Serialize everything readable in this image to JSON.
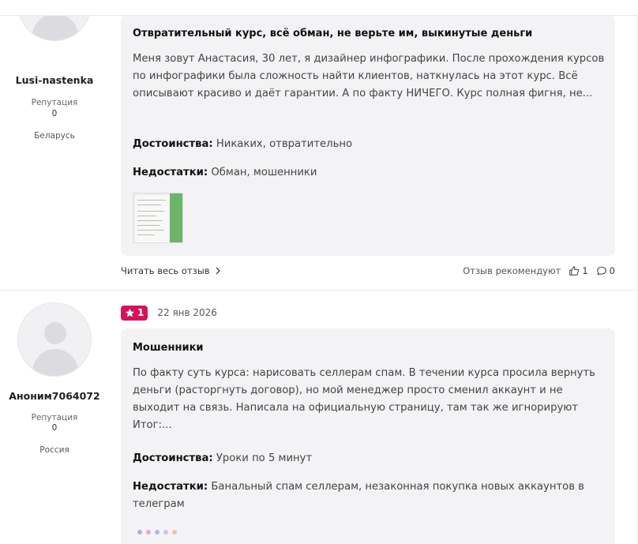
{
  "reviews": [
    {
      "author": {
        "name": "Lusi-nastenka",
        "reputation_label": "Репутация",
        "reputation_value": "0",
        "country": "Беларусь"
      },
      "title": "Отвратительный курс, всё обман, не верьте им, выкинутые деньги",
      "text": "Меня зовут Анастасия, 30 лет, я дизайнер инфографики. После прохождения курсов по инфографики была сложность найти клиентов, наткнулась на этот курс. Всё описывают красиво и даёт гарантии. А по факту НИЧЕГО. Курс полная фигня, не...",
      "pros_label": "Достоинства:",
      "pros": "Никаких, отвратительно",
      "cons_label": "Недостатки:",
      "cons": "Обман, мошенники",
      "read_more": "Читать весь отзыв",
      "recommend_label": "Отзыв рекомендуют",
      "likes": "1",
      "comments": "0"
    },
    {
      "rating": "1",
      "date": "22 янв 2026",
      "author": {
        "name": "Аноним7064072",
        "reputation_label": "Репутация",
        "reputation_value": "0",
        "country": "Россия"
      },
      "title": "Мошенники",
      "text": "По факту суть курса: нарисовать селлерам спам. В течении курса просила вернуть деньги (расторгнуть договор), но мой менеджер просто сменил аккаунт и не выходит на связь. Написала на официальную страницу, там так же игнорируют Итог:...",
      "pros_label": "Достоинства:",
      "pros": "Уроки по 5 минут",
      "cons_label": "Недостатки:",
      "cons": "Банальный спам селлерам, незаконная покупка новых аккаунтов в телеграм"
    }
  ],
  "colors": {
    "accent": "#d2145a",
    "card_bg": "#f3f3f5"
  },
  "icons": [
    "user-avatar-icon",
    "star-icon",
    "chevron-right-icon",
    "thumbs-up-icon",
    "comment-icon"
  ]
}
